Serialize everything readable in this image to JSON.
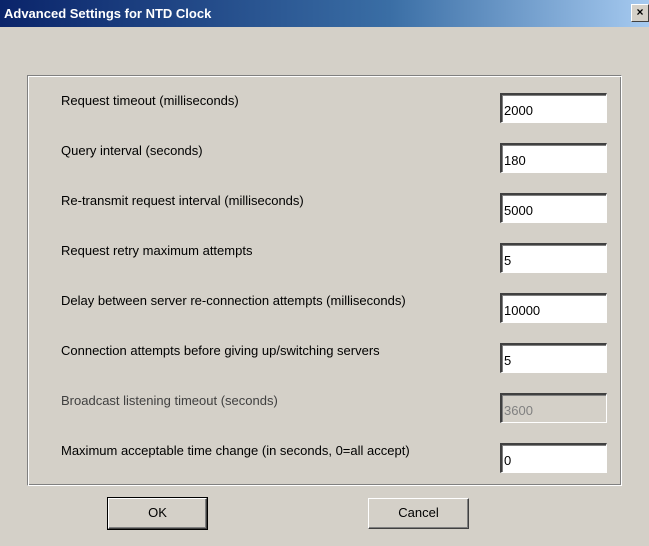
{
  "window": {
    "title": "Advanced Settings for NTD Clock",
    "close_glyph": "×"
  },
  "settings": [
    {
      "label": "Request timeout (milliseconds)",
      "value": "2000",
      "enabled": true
    },
    {
      "label": "Query interval (seconds)",
      "value": "180",
      "enabled": true
    },
    {
      "label": "Re-transmit request interval (milliseconds)",
      "value": "5000",
      "enabled": true
    },
    {
      "label": "Request retry maximum attempts",
      "value": "5",
      "enabled": true
    },
    {
      "label": "Delay between server re-connection attempts (milliseconds)",
      "value": "10000",
      "enabled": true
    },
    {
      "label": "Connection attempts before giving up/switching servers",
      "value": "5",
      "enabled": true
    },
    {
      "label": "Broadcast listening timeout (seconds)",
      "value": "3600",
      "enabled": false
    },
    {
      "label": "Maximum acceptable time change (in seconds, 0=all accept)",
      "value": "0",
      "enabled": true
    }
  ],
  "buttons": {
    "ok_label": "OK",
    "cancel_label": "Cancel"
  }
}
